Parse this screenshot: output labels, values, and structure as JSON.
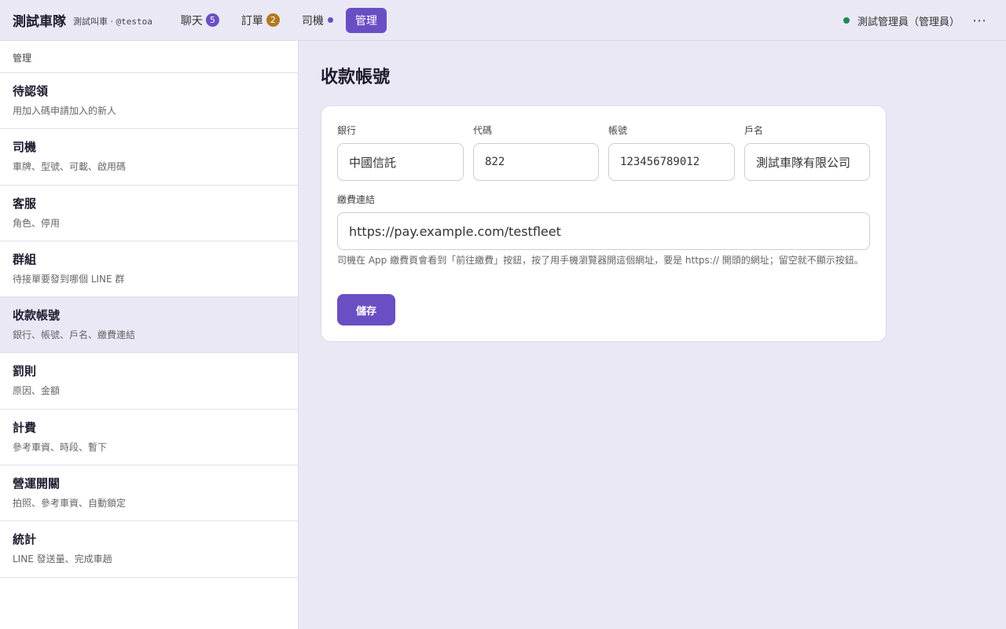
{
  "header": {
    "brand": "測試車隊",
    "subtitle_prefix": "測試叫車 · ",
    "subtitle_handle": "@testoa",
    "nav": [
      {
        "label": "聊天",
        "badge": "5",
        "badge_color": "#6a4fc4"
      },
      {
        "label": "訂單",
        "badge": "2",
        "badge_color": "#b07a1e"
      },
      {
        "label": "司機",
        "dot_color": "#6a4fc4"
      },
      {
        "label": "管理",
        "active": true
      }
    ],
    "user": "測試管理員（管理員）",
    "status_color": "#1e8a4c",
    "more_icon": "more-icon"
  },
  "sidebar": {
    "header": "管理",
    "items": [
      {
        "title": "待認領",
        "desc": "用加入碼申請加入的新人"
      },
      {
        "title": "司機",
        "desc": "車牌、型號、可載、啟用碼"
      },
      {
        "title": "客服",
        "desc": "角色、停用"
      },
      {
        "title": "群組",
        "desc": "待接單要發到哪個 LINE 群"
      },
      {
        "title": "收款帳號",
        "desc": "銀行、帳號、戶名、繳費連結",
        "active": true
      },
      {
        "title": "罰則",
        "desc": "原因、金額"
      },
      {
        "title": "計費",
        "desc": "參考車資、時段、暫下"
      },
      {
        "title": "營運開關",
        "desc": "拍照、參考車資、自動鎖定"
      },
      {
        "title": "統計",
        "desc": "LINE 發送量、完成車趟"
      }
    ]
  },
  "main": {
    "title": "收款帳號",
    "form": {
      "bank_label": "銀行",
      "bank_value": "中國信託",
      "code_label": "代碼",
      "code_value": "822",
      "account_label": "帳號",
      "account_value": "123456789012",
      "name_label": "戶名",
      "name_value": "測試車隊有限公司",
      "link_label": "繳費連結",
      "link_value": "https://pay.example.com/testfleet",
      "help": "司機在 App 繳費頁會看到「前往繳費」按鈕，按了用手機瀏覽器開這個網址，要是 https:// 開頭的網址；留空就不顯示按鈕。",
      "save_label": "儲存"
    }
  },
  "colors": {
    "accent": "#6a4fc4",
    "background": "#ebe8f5"
  }
}
